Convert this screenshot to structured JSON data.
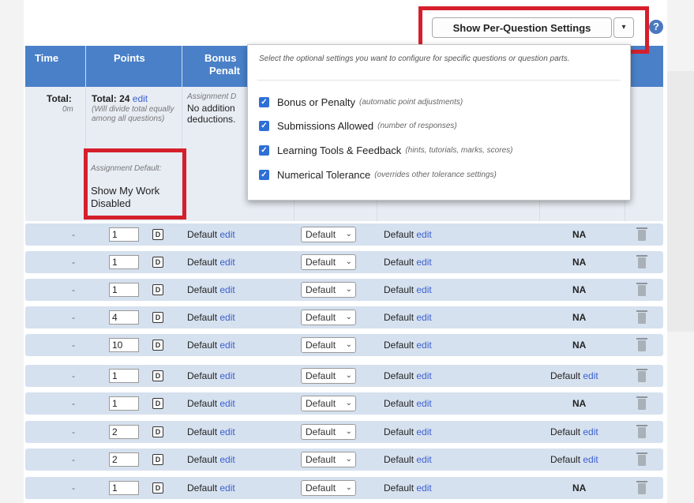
{
  "toolbar": {
    "per_question_button": "Show Per-Question Settings",
    "caret": "▾",
    "help": "?"
  },
  "headers": {
    "time": "Time",
    "points": "Points",
    "bonus": "Bonus",
    "bonus_line2": "Penalt"
  },
  "summary": {
    "time_total": "Total:",
    "time_value": "0m",
    "points_total": "Total: 24",
    "points_edit": "edit",
    "points_note": "(Will divide total equally among all questions)",
    "assignment_default_label": "Assignment Default:",
    "show_my_work": "Show My Work Disabled",
    "bonus_label": "Assignment D",
    "bonus_text": "No addition deductions."
  },
  "popup": {
    "hint": "Select the optional settings you want to configure for specific questions or question parts.",
    "options": [
      {
        "label": "Bonus or Penalty",
        "sub": "(automatic point adjustments)"
      },
      {
        "label": "Submissions Allowed",
        "sub": "(number of responses)"
      },
      {
        "label": "Learning Tools & Feedback",
        "sub": "(hints, tutorials, marks, scores)"
      },
      {
        "label": "Numerical Tolerance",
        "sub": "(overrides other tolerance settings)"
      }
    ]
  },
  "rows_common": {
    "time": "-",
    "default": "Default",
    "edit": "edit",
    "select": "Default",
    "chev": "⌄",
    "d_icon": "D"
  },
  "rows": [
    {
      "points": "1",
      "last": "NA",
      "last_edit": ""
    },
    {
      "points": "1",
      "last": "NA",
      "last_edit": ""
    },
    {
      "points": "1",
      "last": "NA",
      "last_edit": ""
    },
    {
      "points": "4",
      "last": "NA",
      "last_edit": ""
    },
    {
      "points": "10",
      "last": "NA",
      "last_edit": ""
    },
    {
      "points": "1",
      "last": "Default",
      "last_edit": "edit"
    },
    {
      "points": "1",
      "last": "NA",
      "last_edit": ""
    },
    {
      "points": "2",
      "last": "Default",
      "last_edit": "edit"
    },
    {
      "points": "2",
      "last": "Default",
      "last_edit": "edit"
    },
    {
      "points": "1",
      "last": "NA",
      "last_edit": ""
    }
  ]
}
